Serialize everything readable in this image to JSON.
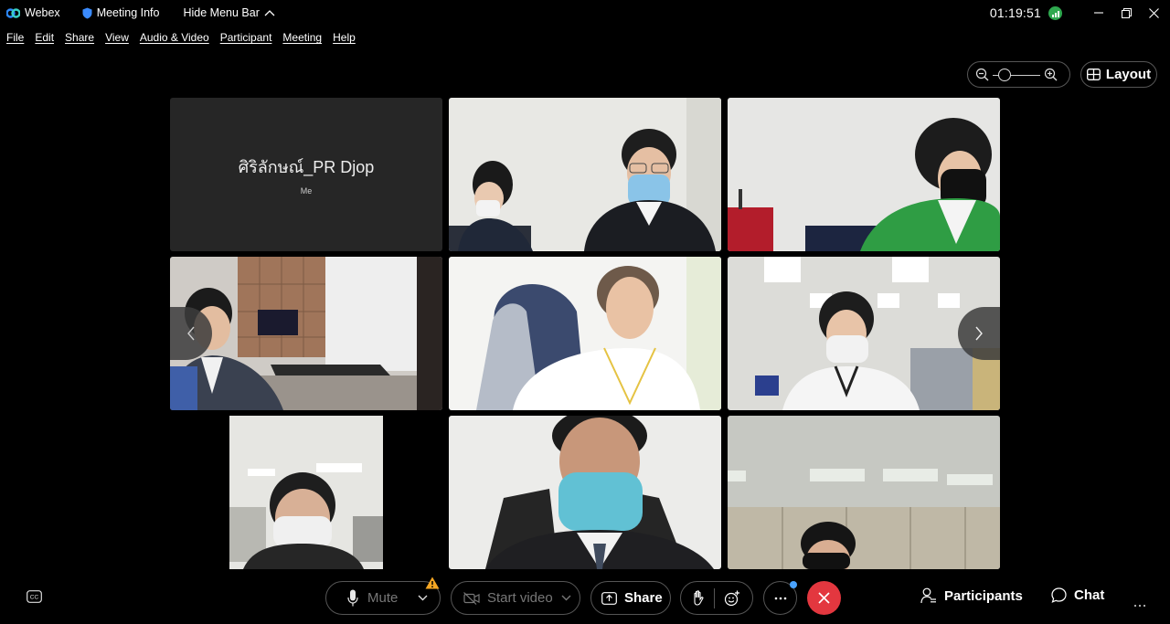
{
  "titlebar": {
    "app_name": "Webex",
    "meeting_info": "Meeting Info",
    "hide_menu": "Hide Menu Bar",
    "clock": "01:19:51"
  },
  "menu": [
    "File",
    "Edit",
    "Share",
    "View",
    "Audio & Video",
    "Participant",
    "Meeting",
    "Help"
  ],
  "layout_label": "Layout",
  "me_tile": {
    "name": "ศิริลักษณ์_PR Djop",
    "sub": "Me"
  },
  "bottom": {
    "mute": "Mute",
    "start_video": "Start video",
    "share": "Share",
    "participants": "Participants",
    "chat": "Chat"
  },
  "colors": {
    "end_call": "#e3373f",
    "warning": "#f5a623",
    "signal": "#2fa84f",
    "notify_dot": "#4aa3ff"
  }
}
